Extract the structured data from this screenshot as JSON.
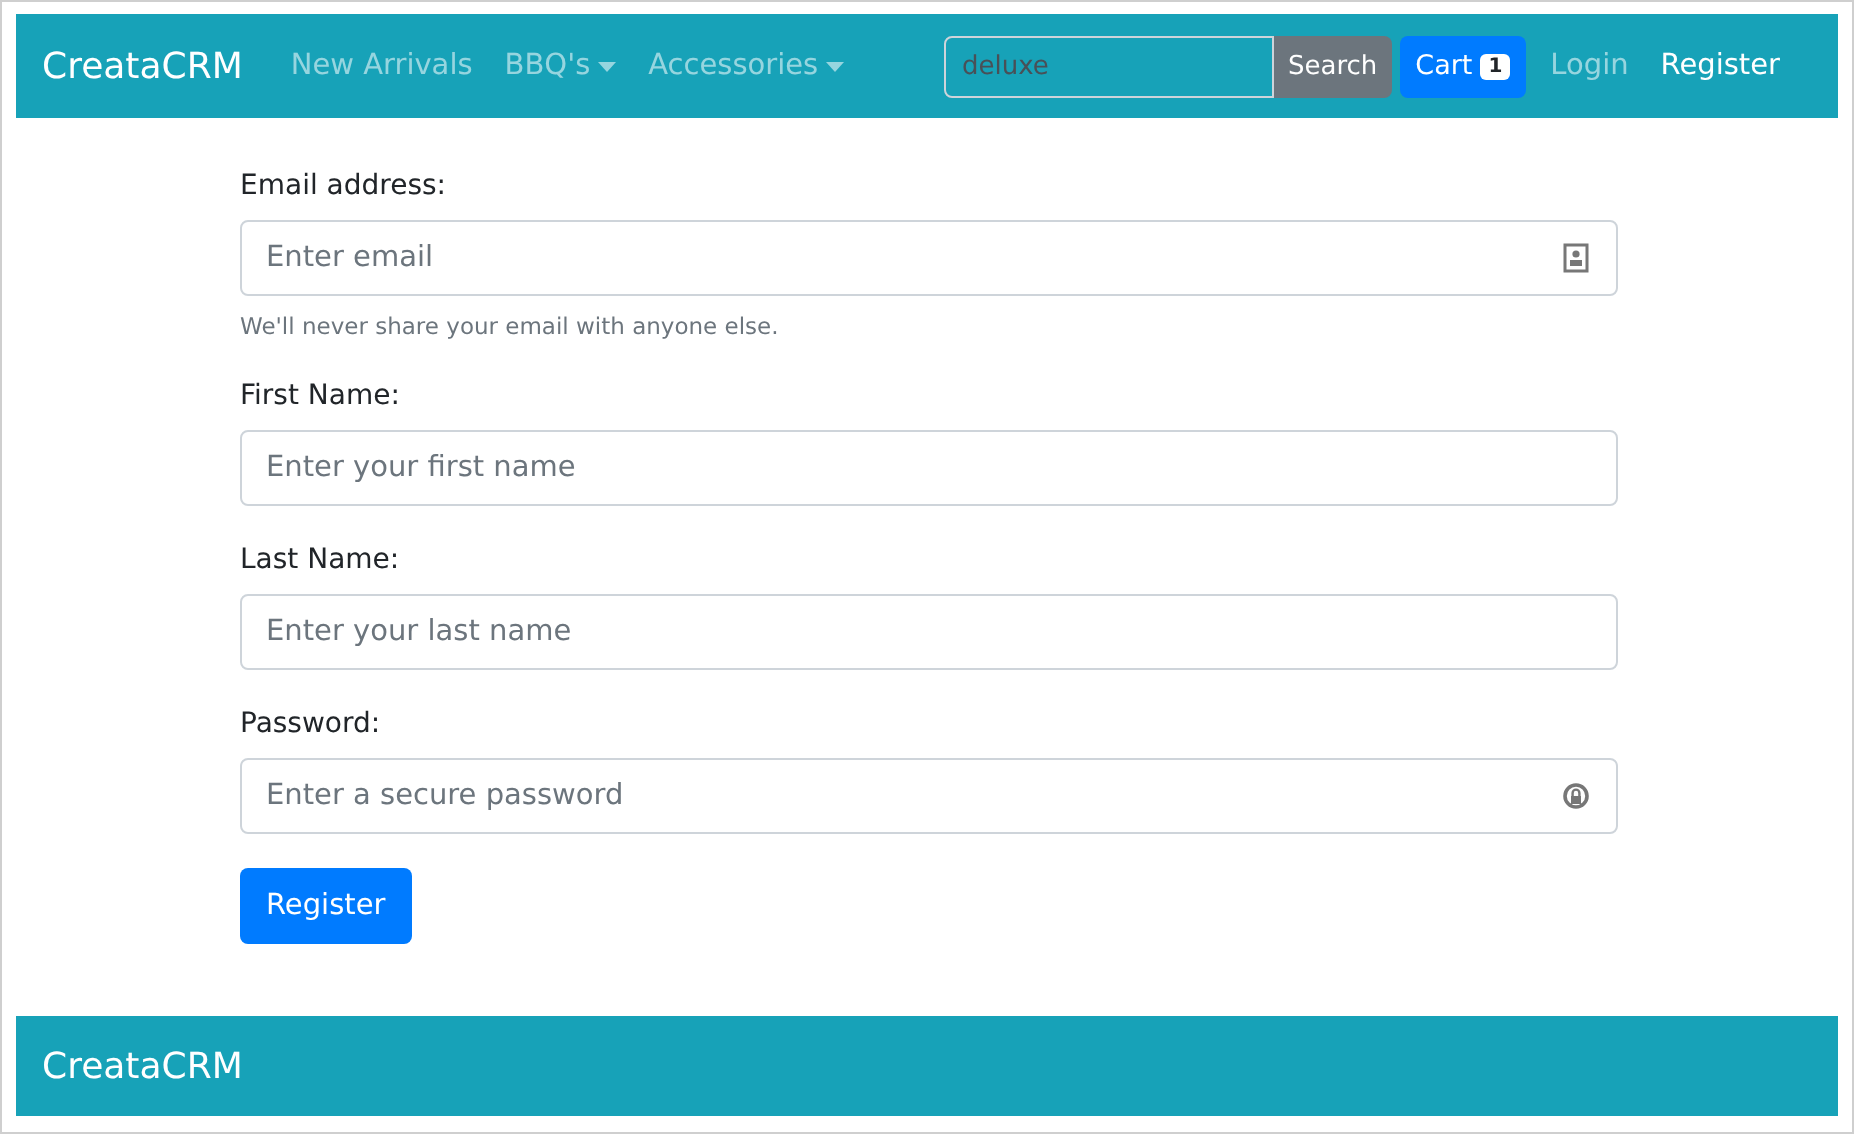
{
  "navbar": {
    "brand": "CreataCRM",
    "links": [
      {
        "label": "New Arrivals",
        "dropdown": false
      },
      {
        "label": "BBQ's",
        "dropdown": true
      },
      {
        "label": "Accessories",
        "dropdown": true
      }
    ],
    "search": {
      "value": "deluxe",
      "button": "Search"
    },
    "cart": {
      "label": "Cart",
      "count": "1"
    },
    "auth_links": [
      {
        "label": "Login",
        "selected": false
      },
      {
        "label": "Register",
        "selected": true
      }
    ]
  },
  "form": {
    "fields": [
      {
        "label": "Email address:",
        "placeholder": "Enter email",
        "kind": "email",
        "help": "We'll never share your email with anyone else."
      },
      {
        "label": "First Name:",
        "placeholder": "Enter your first name"
      },
      {
        "label": "Last Name:",
        "placeholder": "Enter your last name"
      },
      {
        "label": "Password:",
        "placeholder": "Enter a secure password",
        "kind": "password"
      }
    ],
    "submit": "Register"
  },
  "footer": {
    "brand": "CreataCRM"
  }
}
